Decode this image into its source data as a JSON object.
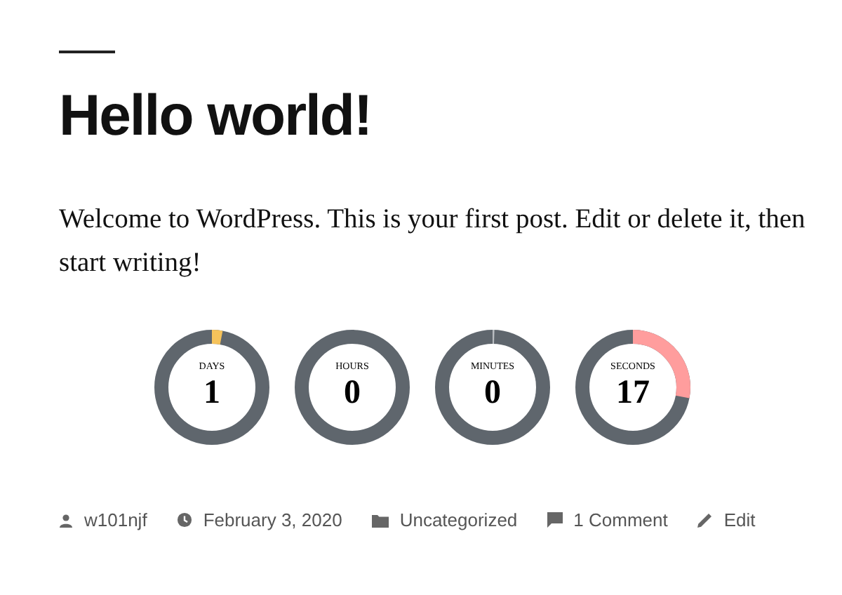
{
  "post": {
    "title": "Hello world!",
    "body": "Welcome to WordPress. This is your first post. Edit or delete it, then start writing!"
  },
  "countdown": [
    {
      "label": "DAYS",
      "value": "1",
      "level": 0.03,
      "color": "#f6c35b"
    },
    {
      "label": "HOURS",
      "value": "0",
      "level": 0,
      "color": "#5f666d"
    },
    {
      "label": "MINUTES",
      "value": "0",
      "level": 0,
      "color": "#b8bcc0"
    },
    {
      "label": "SECONDS",
      "value": "17",
      "level": 0.28,
      "color": "#ff9d9d"
    }
  ],
  "meta": [
    {
      "kind": "author",
      "text": "w101njf"
    },
    {
      "kind": "date",
      "text": "February 3, 2020"
    },
    {
      "kind": "category",
      "text": "Uncategorized"
    },
    {
      "kind": "comments",
      "text": "1 Comment"
    },
    {
      "kind": "edit",
      "text": "Edit"
    }
  ]
}
